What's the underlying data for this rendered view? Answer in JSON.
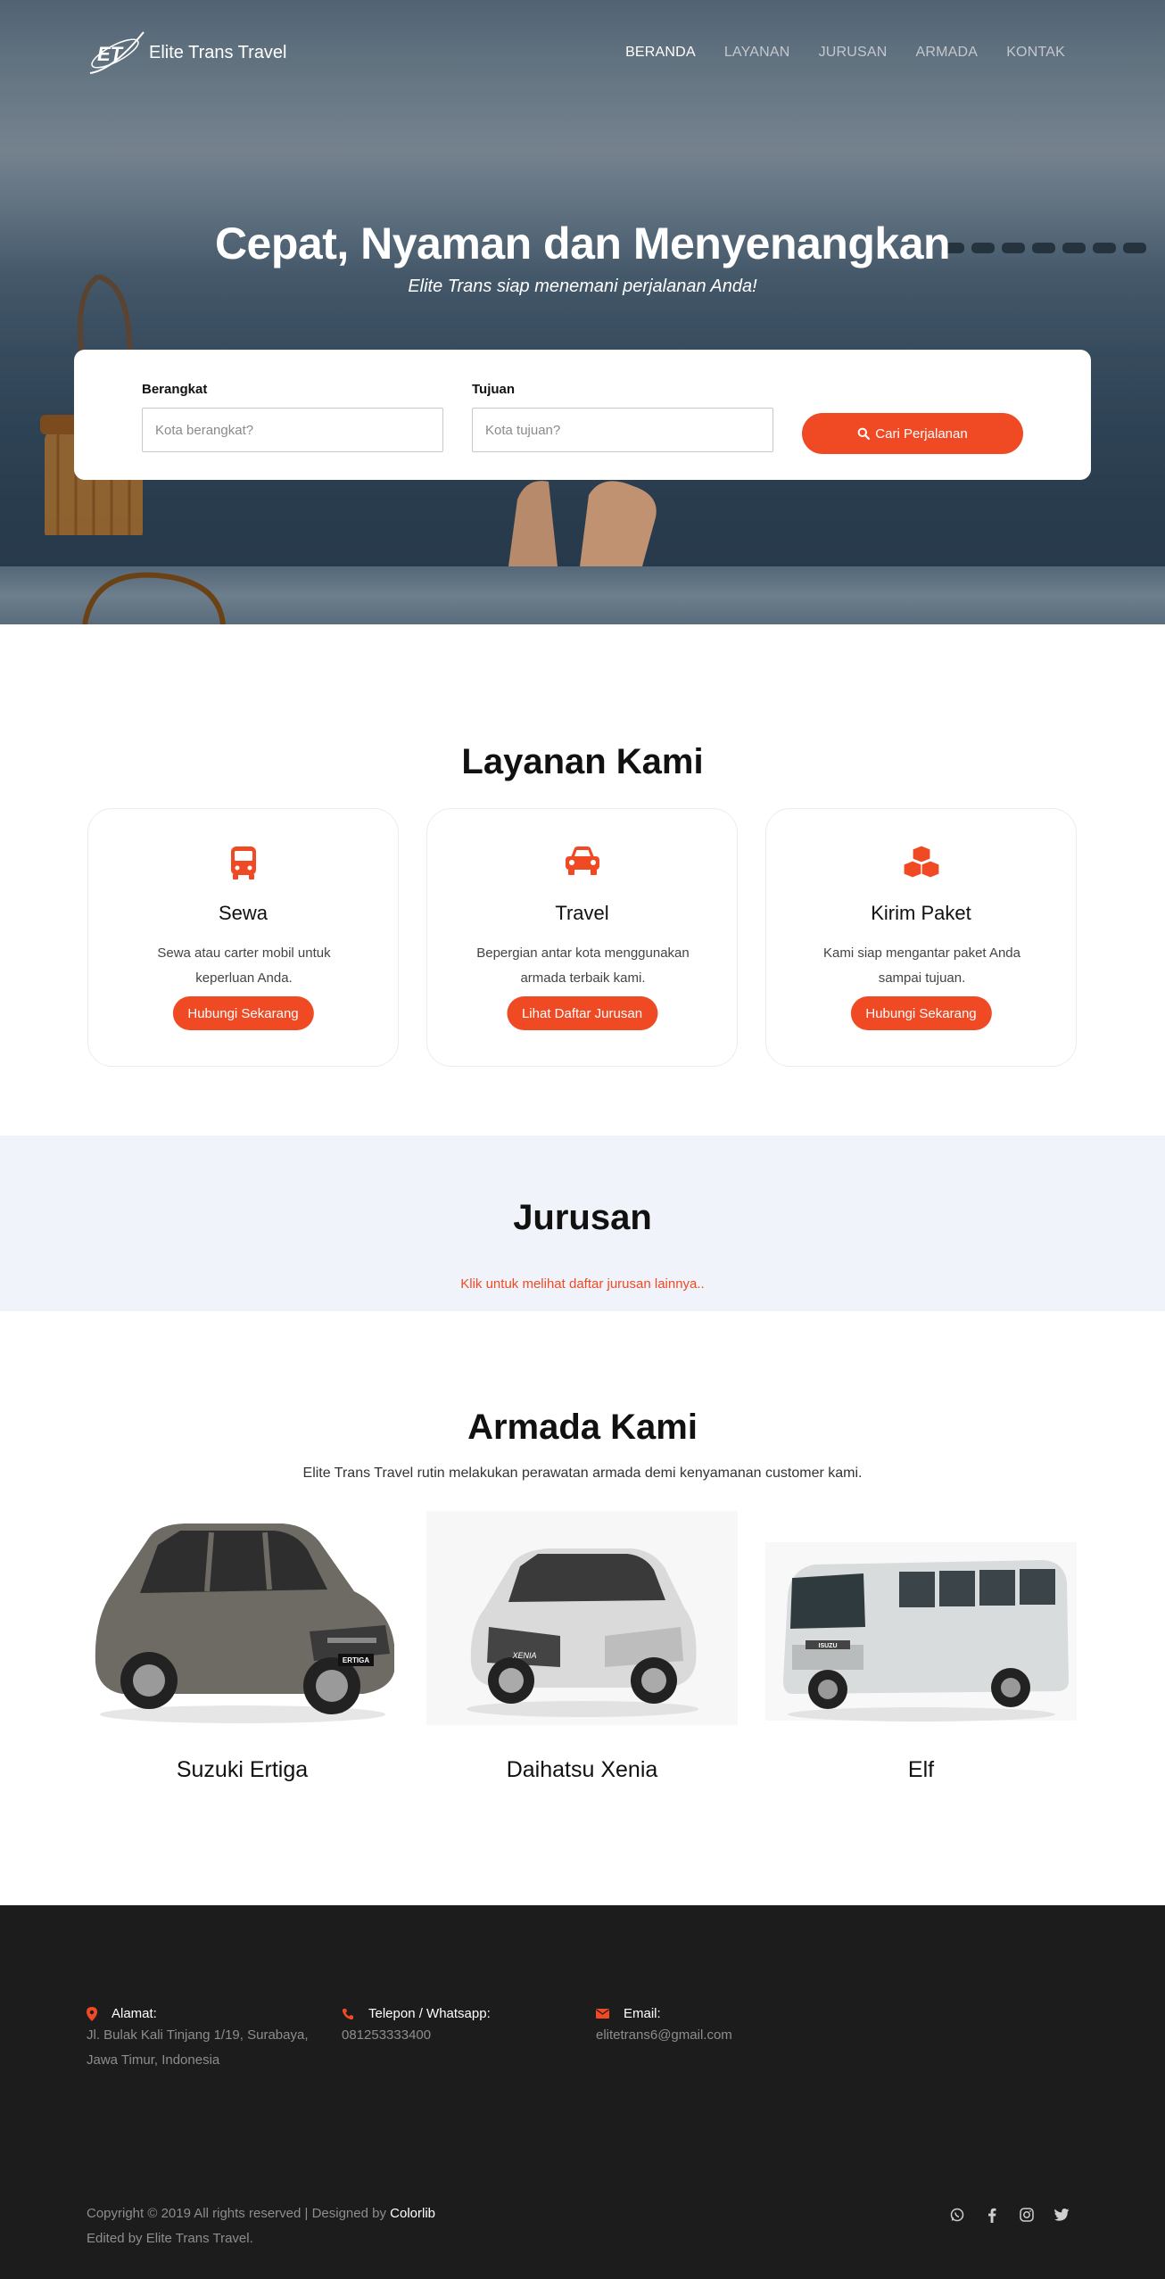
{
  "brand": {
    "logo_text": "ET",
    "name": "Elite Trans Travel"
  },
  "nav": {
    "items": [
      {
        "label": "BERANDA",
        "active": true
      },
      {
        "label": "LAYANAN",
        "active": false
      },
      {
        "label": "JURUSAN",
        "active": false
      },
      {
        "label": "ARMADA",
        "active": false
      },
      {
        "label": "KONTAK",
        "active": false
      }
    ]
  },
  "hero": {
    "title": "Cepat, Nyaman dan Menyenangkan",
    "subtitle": "Elite Trans siap menemani perjalanan Anda!"
  },
  "search": {
    "from_label": "Berangkat",
    "from_placeholder": "Kota berangkat?",
    "to_label": "Tujuan",
    "to_placeholder": "Kota tujuan?",
    "button_label": "Cari Perjalanan",
    "button_icon": "search-icon"
  },
  "services": {
    "title": "Layanan Kami",
    "items": [
      {
        "icon": "bus-icon",
        "title": "Sewa",
        "desc": "Sewa atau carter mobil untuk keperluan Anda.",
        "button": "Hubungi Sekarang"
      },
      {
        "icon": "car-icon",
        "title": "Travel",
        "desc": "Bepergian antar kota menggunakan armada terbaik kami.",
        "button": "Lihat Daftar Jurusan"
      },
      {
        "icon": "cubes-icon",
        "title": "Kirim Paket",
        "desc": "Kami siap mengantar paket Anda sampai tujuan.",
        "button": "Hubungi Sekarang"
      }
    ]
  },
  "routes": {
    "title": "Jurusan",
    "link": "Klik untuk melihat daftar jurusan lainnya.."
  },
  "fleet": {
    "title": "Armada Kami",
    "subtitle": "Elite Trans Travel rutin melakukan perawatan armada demi kenyamanan customer kami.",
    "cars": [
      {
        "name": "Suzuki Ertiga",
        "badge": "ERTIGA"
      },
      {
        "name": "Daihatsu Xenia",
        "badge": "XENIA"
      },
      {
        "name": "Elf",
        "badge": "ISUZU"
      }
    ]
  },
  "footer": {
    "address_label": "Alamat:",
    "address_line1": "Jl. Bulak Kali Tinjang 1/19, Surabaya,",
    "address_line2": "Jawa Timur, Indonesia",
    "phone_label": "Telepon / Whatsapp:",
    "phone": "081253333400",
    "email_label": "Email:",
    "email": "elitetrans6@gmail.com",
    "copyright_prefix": "Copyright © 2019 All rights reserved | Designed by",
    "designer": "Colorlib",
    "edited_by": "Edited by Elite Trans Travel.",
    "social_icons": [
      "whatsapp-icon",
      "facebook-icon",
      "instagram-icon",
      "twitter-icon"
    ]
  },
  "colors": {
    "accent": "#f04a25",
    "footer_bg": "#1c1c1d",
    "routes_bg": "#f0f3fa"
  }
}
